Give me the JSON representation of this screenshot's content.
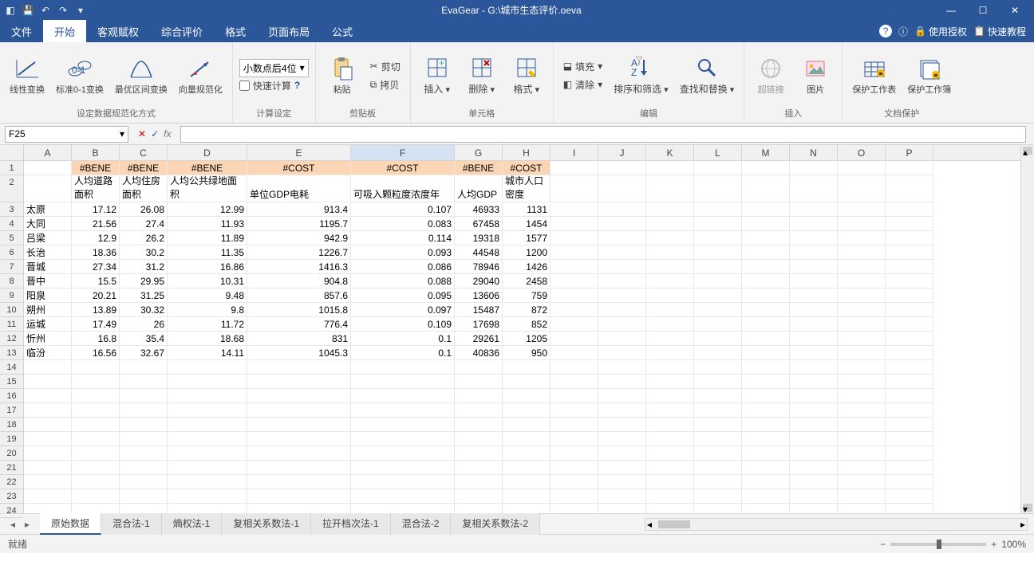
{
  "title": "EvaGear -  G:\\城市生态评价.oeva",
  "qat": [
    "save",
    "undo",
    "redo",
    "dropdown"
  ],
  "menu": {
    "tabs": [
      "文件",
      "开始",
      "客观赋权",
      "综合评价",
      "格式",
      "页面布局",
      "公式"
    ],
    "active": 1,
    "right": {
      "help": "?",
      "info": "ⓘ",
      "auth": "使用授权",
      "tut": "快速教程"
    }
  },
  "ribbon": {
    "g1": {
      "lbl": "设定数据规范化方式",
      "btns": [
        "线性变换",
        "标准0-1变换",
        "最优区间变换",
        "向量规范化"
      ]
    },
    "g2": {
      "lbl": "计算设定",
      "combo": "小数点后4位",
      "chk": "快速计算"
    },
    "g3": {
      "lbl": "剪贴板",
      "paste": "粘贴",
      "cut": "剪切",
      "copy": "拷贝"
    },
    "g4": {
      "lbl": "单元格",
      "ins": "插入",
      "del": "删除",
      "fmt": "格式"
    },
    "g5": {
      "lbl": "编辑",
      "fill": "填充",
      "clear": "清除",
      "sort": "排序和筛选",
      "find": "查找和替换"
    },
    "g6": {
      "lbl": "插入",
      "link": "超链接",
      "pic": "图片"
    },
    "g7": {
      "lbl": "文档保护",
      "ws": "保护工作表",
      "wb": "保护工作簿"
    }
  },
  "namebox": "F25",
  "cols": [
    "A",
    "B",
    "C",
    "D",
    "E",
    "F",
    "G",
    "H",
    "I",
    "J",
    "K",
    "L",
    "M",
    "N",
    "O",
    "P"
  ],
  "cw": [
    60,
    60,
    60,
    100,
    130,
    130,
    60,
    60,
    60,
    60,
    60,
    60,
    60,
    60,
    60,
    60
  ],
  "r1": [
    "",
    "#BENE",
    "#BENE",
    "#BENE",
    "#COST",
    "#COST",
    "#BENE",
    "#COST",
    "",
    "",
    "",
    "",
    "",
    "",
    "",
    ""
  ],
  "r2": [
    "",
    "人均道路面积",
    "人均住房面积",
    "人均公共绿地面积",
    "单位GDP电耗",
    "可吸入颗粒度浓度年",
    "人均GDP",
    "城市人口密度",
    "",
    "",
    "",
    "",
    "",
    "",
    "",
    ""
  ],
  "data": [
    [
      "太原",
      "17.12",
      "26.08",
      "12.99",
      "913.4",
      "0.107",
      "46933",
      "1131"
    ],
    [
      "大同",
      "21.56",
      "27.4",
      "11.93",
      "1195.7",
      "0.083",
      "67458",
      "1454"
    ],
    [
      "吕梁",
      "12.9",
      "26.2",
      "11.89",
      "942.9",
      "0.114",
      "19318",
      "1577"
    ],
    [
      "长治",
      "18.36",
      "30.2",
      "11.35",
      "1226.7",
      "0.093",
      "44548",
      "1200"
    ],
    [
      "晋城",
      "27.34",
      "31.2",
      "16.86",
      "1416.3",
      "0.086",
      "78946",
      "1426"
    ],
    [
      "晋中",
      "15.5",
      "29.95",
      "10.31",
      "904.8",
      "0.088",
      "29040",
      "2458"
    ],
    [
      "阳泉",
      "20.21",
      "31.25",
      "9.48",
      "857.6",
      "0.095",
      "13606",
      "759"
    ],
    [
      "朔州",
      "13.89",
      "30.32",
      "9.8",
      "1015.8",
      "0.097",
      "15487",
      "872"
    ],
    [
      "运城",
      "17.49",
      "26",
      "11.72",
      "776.4",
      "0.109",
      "17698",
      "852"
    ],
    [
      "忻州",
      "16.8",
      "35.4",
      "18.68",
      "831",
      "0.1",
      "29261",
      "1205"
    ],
    [
      "临汾",
      "16.56",
      "32.67",
      "14.11",
      "1045.3",
      "0.1",
      "40836",
      "950"
    ]
  ],
  "sheets": [
    "原始数据",
    "混合法-1",
    "熵权法-1",
    "复相关系数法-1",
    "拉开档次法-1",
    "混合法-2",
    "复相关系数法-2"
  ],
  "activeSheet": 0,
  "status": "就绪",
  "zoom": "100%"
}
